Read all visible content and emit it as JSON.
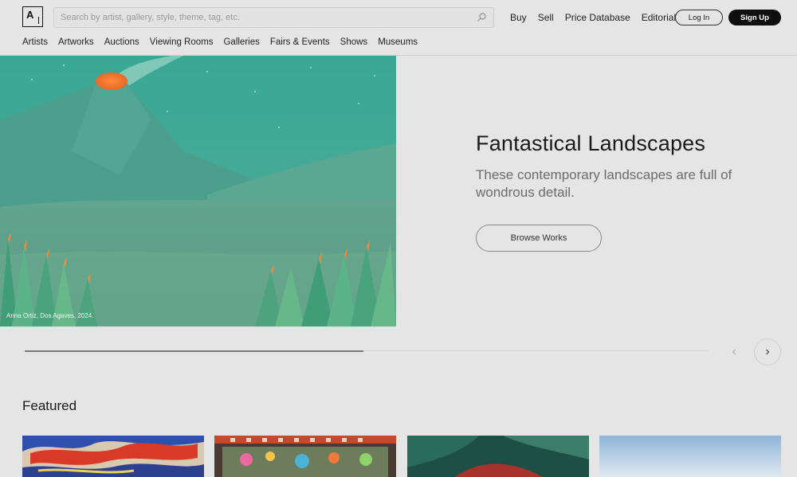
{
  "header": {
    "logo_text": "A",
    "search": {
      "placeholder": "Search by artist, gallery, style, theme, tag, etc.",
      "value": ""
    },
    "top_nav": [
      {
        "label": "Buy"
      },
      {
        "label": "Sell"
      },
      {
        "label": "Price Database"
      },
      {
        "label": "Editorial"
      }
    ],
    "login_label": "Log In",
    "signup_label": "Sign Up",
    "sub_nav": [
      {
        "label": "Artists"
      },
      {
        "label": "Artworks"
      },
      {
        "label": "Auctions"
      },
      {
        "label": "Viewing Rooms"
      },
      {
        "label": "Galleries"
      },
      {
        "label": "Fairs & Events"
      },
      {
        "label": "Shows"
      },
      {
        "label": "Museums"
      }
    ]
  },
  "hero": {
    "caption": "Anna Ortiz, Dos Agaves, 2024.",
    "title": "Fantastical Landscapes",
    "description": "These contemporary landscapes are full of wondrous detail.",
    "cta_label": "Browse Works"
  },
  "carousel": {
    "progress_fraction": 0.5,
    "prev_icon": "chevron-left-icon",
    "next_icon": "chevron-right-icon"
  },
  "featured": {
    "title": "Featured"
  },
  "colors": {
    "background": "#e5e5e5",
    "text": "#111111",
    "muted_text": "#6b6b6b",
    "signup_bg": "#0f0f0f",
    "hero_teal": "#3b9a8a"
  }
}
